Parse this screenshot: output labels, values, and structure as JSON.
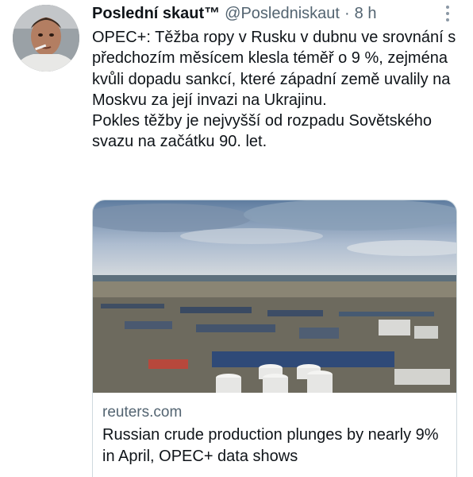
{
  "tweet": {
    "author_name": "Poslední skaut™",
    "handle": "@Posledniskaut",
    "separator": "·",
    "time": "8 h",
    "text_lines": [
      "OPEC+: Těžba ropy v Rusku v dubnu ve srovnání s předchozím měsícem klesla téměř o 9 %, zejména kvůli dopadu sankcí, které západní země uvalily na Moskvu za její invazi na Ukrajinu.",
      "Pokles těžby je nejvyšší od rozpadu Sovětského svazu na začátku 90. let."
    ]
  },
  "card": {
    "domain": "reuters.com",
    "title": "Russian crude production plunges by nearly 9% in April, OPEC+ data shows"
  },
  "icons": {
    "more": "more-options-icon",
    "avatar": "avatar-image"
  },
  "colors": {
    "text": "#0f1419",
    "secondary": "#536471",
    "card_border": "#cfd9de"
  }
}
